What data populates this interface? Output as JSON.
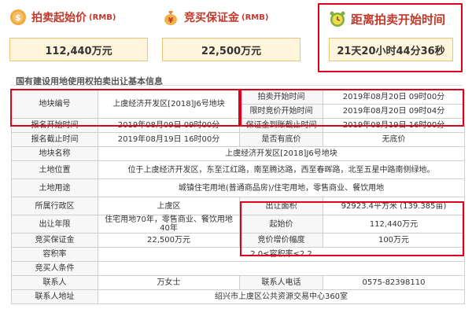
{
  "summary": {
    "start_price": {
      "label": "拍卖起始价",
      "unit": "(RMB)",
      "value": "112,440万元"
    },
    "deposit": {
      "label": "竞买保证金",
      "unit": "(RMB)",
      "value": "22,500万元"
    },
    "countdown": {
      "label": "距离拍卖开始时间",
      "value": "21天20小时44分36秒"
    }
  },
  "section_title": "国有建设用地使用权拍卖出让基本信息",
  "table": {
    "parcel_no_label": "地块编号",
    "parcel_no": "上虞经济开发区[2018]J6号地块",
    "auction_start_label": "拍卖开始时间",
    "auction_start": "2019年08月20日 09时00分",
    "bid_start_label": "限时竞价开始时间",
    "bid_start": "2019年08月20日 09时04分",
    "signup_start_label": "报名开始时间",
    "signup_start": "2019年08月09日 09时00分",
    "deposit_deadline_label": "保证金到账截止时间",
    "deposit_deadline": "2019年08月19日 16时00分",
    "signup_end_label": "报名截止时间",
    "signup_end": "2019年08月19日 16时00分",
    "reserve_label": "是否有底价",
    "reserve": "无底价",
    "parcel_name_label": "地块名称",
    "parcel_name": "上虞经济开发区[2018]J6号地块",
    "location_label": "土地位置",
    "location": "位于上虞经济开发区，东至江红路，南至腾达路，西至春晖路，北至五星中路南侧绿地。",
    "usage_label": "土地用途",
    "usage": "城镇住宅用地(普通商品房)/住宅用地，零售商业、餐饮用地",
    "district_label": "所属行政区",
    "district": "上虞区",
    "area_label": "出让面积",
    "area": "92923.4平方米 (139.385亩)",
    "term_label": "出让年限",
    "term": "住宅用地70年，零售商业、餐饮用地40年",
    "start_price_label": "起始价",
    "start_price": "112,440万元",
    "deposit_label": "竞买保证金",
    "deposit": "22,500万元",
    "increment_label": "竞价增价幅度",
    "increment": "100万元",
    "far_label": "容积率",
    "far": "2.0≤容积率≤2.2",
    "conditions_label": "竞买人条件",
    "conditions": "",
    "contact_label": "联系人",
    "contact": "万女士",
    "phone_label": "联系人电话",
    "phone": "0575-82398110",
    "address_label": "联系人地址",
    "address": "绍兴市上虞区公共资源交易中心360室"
  },
  "colors": {
    "accent": "#e0001a",
    "title": "#c0392b",
    "box_bg": "#fff4dc",
    "box_border": "#e8c47a"
  }
}
